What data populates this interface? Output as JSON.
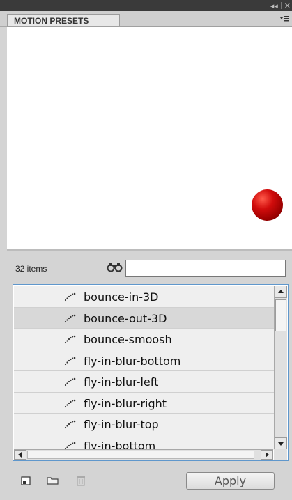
{
  "window": {
    "collapse_glyph": "◂◂",
    "close_glyph": "✕"
  },
  "panel": {
    "tab_title": "MOTION PRESETS",
    "menu_icon": "panel-menu-icon"
  },
  "preview": {
    "object": "red-sphere",
    "color": "#cc0000"
  },
  "list": {
    "count_label": "32 items",
    "search": {
      "value": "",
      "placeholder": ""
    },
    "items": [
      {
        "label": "bounce-in-3D",
        "selected": false
      },
      {
        "label": "bounce-out-3D",
        "selected": true
      },
      {
        "label": "bounce-smoosh",
        "selected": false
      },
      {
        "label": "fly-in-blur-bottom",
        "selected": false
      },
      {
        "label": "fly-in-blur-left",
        "selected": false
      },
      {
        "label": "fly-in-blur-right",
        "selected": false
      },
      {
        "label": "fly-in-blur-top",
        "selected": false
      },
      {
        "label": "fly-in-bottom",
        "selected": false
      }
    ]
  },
  "footer": {
    "apply_label": "Apply"
  },
  "colors": {
    "list_border": "#5f97cc",
    "selected_row": "#d8d8d8",
    "titlebar": "#3a3a3a"
  }
}
